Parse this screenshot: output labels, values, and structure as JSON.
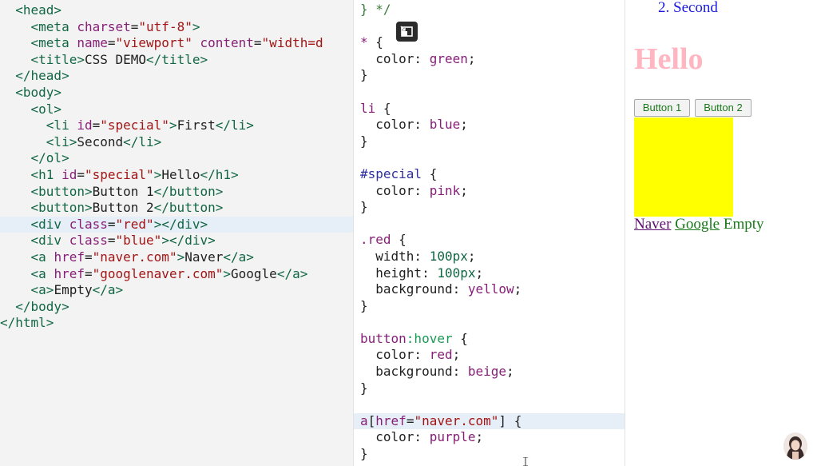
{
  "editor": {
    "html_lines": [
      {
        "indent": "  ",
        "parts": [
          [
            "tag",
            "<head>"
          ]
        ]
      },
      {
        "indent": "    ",
        "parts": [
          [
            "tag",
            "<meta "
          ],
          [
            "attr",
            "charset"
          ],
          [
            "txt",
            "="
          ],
          [
            "str",
            "\"utf-8\""
          ],
          [
            "tag",
            ">"
          ]
        ]
      },
      {
        "indent": "    ",
        "parts": [
          [
            "tag",
            "<meta "
          ],
          [
            "attr",
            "name"
          ],
          [
            "txt",
            "="
          ],
          [
            "str",
            "\"viewport\""
          ],
          [
            "txt",
            " "
          ],
          [
            "attr",
            "content"
          ],
          [
            "txt",
            "="
          ],
          [
            "str",
            "\"width=d"
          ]
        ]
      },
      {
        "indent": "    ",
        "parts": [
          [
            "tag",
            "<title>"
          ],
          [
            "txt",
            "CSS DEMO"
          ],
          [
            "tag",
            "</title>"
          ]
        ]
      },
      {
        "indent": "  ",
        "parts": [
          [
            "tag",
            "</head>"
          ]
        ]
      },
      {
        "indent": "  ",
        "parts": [
          [
            "tag",
            "<body>"
          ]
        ]
      },
      {
        "indent": "    ",
        "parts": [
          [
            "tag",
            "<ol>"
          ]
        ]
      },
      {
        "indent": "      ",
        "parts": [
          [
            "tag",
            "<li "
          ],
          [
            "attr",
            "id"
          ],
          [
            "txt",
            "="
          ],
          [
            "str",
            "\"special\""
          ],
          [
            "tag",
            ">"
          ],
          [
            "txt",
            "First"
          ],
          [
            "tag",
            "</li>"
          ]
        ]
      },
      {
        "indent": "      ",
        "parts": [
          [
            "tag",
            "<li>"
          ],
          [
            "txt",
            "Second"
          ],
          [
            "tag",
            "</li>"
          ]
        ]
      },
      {
        "indent": "    ",
        "parts": [
          [
            "tag",
            "</ol>"
          ]
        ]
      },
      {
        "indent": "    ",
        "parts": [
          [
            "tag",
            "<h1 "
          ],
          [
            "attr",
            "id"
          ],
          [
            "txt",
            "="
          ],
          [
            "str",
            "\"special\""
          ],
          [
            "tag",
            ">"
          ],
          [
            "txt",
            "Hello"
          ],
          [
            "tag",
            "</h1>"
          ]
        ]
      },
      {
        "indent": "    ",
        "parts": [
          [
            "tag",
            "<button>"
          ],
          [
            "txt",
            "Button 1"
          ],
          [
            "tag",
            "</button>"
          ]
        ]
      },
      {
        "indent": "    ",
        "parts": [
          [
            "tag",
            "<button>"
          ],
          [
            "txt",
            "Button 2"
          ],
          [
            "tag",
            "</button>"
          ]
        ]
      },
      {
        "indent": "    ",
        "parts": [
          [
            "tag",
            "<div "
          ],
          [
            "attr",
            "class"
          ],
          [
            "txt",
            "="
          ],
          [
            "str",
            "\"red\""
          ],
          [
            "tag",
            "></div>"
          ]
        ],
        "active": true
      },
      {
        "indent": "    ",
        "parts": [
          [
            "tag",
            "<div "
          ],
          [
            "attr",
            "class"
          ],
          [
            "txt",
            "="
          ],
          [
            "str",
            "\"blue\""
          ],
          [
            "tag",
            "></div>"
          ]
        ]
      },
      {
        "indent": "    ",
        "parts": [
          [
            "tag",
            "<a "
          ],
          [
            "attr",
            "href"
          ],
          [
            "txt",
            "="
          ],
          [
            "str",
            "\"naver.com\""
          ],
          [
            "tag",
            ">"
          ],
          [
            "txt",
            "Naver"
          ],
          [
            "tag",
            "</a>"
          ]
        ]
      },
      {
        "indent": "    ",
        "parts": [
          [
            "tag",
            "<a "
          ],
          [
            "attr",
            "href"
          ],
          [
            "txt",
            "="
          ],
          [
            "str",
            "\"googlenaver.com\""
          ],
          [
            "tag",
            ">"
          ],
          [
            "txt",
            "Google"
          ],
          [
            "tag",
            "</a>"
          ]
        ]
      },
      {
        "indent": "    ",
        "parts": [
          [
            "tag",
            "<a>"
          ],
          [
            "txt",
            "Empty"
          ],
          [
            "tag",
            "</a>"
          ]
        ]
      },
      {
        "indent": "  ",
        "parts": [
          [
            "tag",
            "</body>"
          ]
        ]
      },
      {
        "indent": "",
        "parts": [
          [
            "tag",
            "</html>"
          ]
        ]
      }
    ],
    "css_lines": [
      {
        "parts": [
          [
            "c-comment",
            "} */"
          ]
        ]
      },
      {
        "parts": []
      },
      {
        "parts": [
          [
            "c-sel",
            "* "
          ],
          [
            "c-punc",
            "{"
          ]
        ]
      },
      {
        "parts": [
          [
            "c-prop",
            "  color: "
          ],
          [
            "c-val",
            "green"
          ],
          [
            "c-punc",
            ";"
          ]
        ]
      },
      {
        "parts": [
          [
            "c-punc",
            "}"
          ]
        ]
      },
      {
        "parts": []
      },
      {
        "parts": [
          [
            "c-sel",
            "li "
          ],
          [
            "c-punc",
            "{"
          ]
        ]
      },
      {
        "parts": [
          [
            "c-prop",
            "  color: "
          ],
          [
            "c-val",
            "blue"
          ],
          [
            "c-punc",
            ";"
          ]
        ]
      },
      {
        "parts": [
          [
            "c-punc",
            "}"
          ]
        ]
      },
      {
        "parts": []
      },
      {
        "parts": [
          [
            "c-id",
            "#special "
          ],
          [
            "c-punc",
            "{"
          ]
        ]
      },
      {
        "parts": [
          [
            "c-prop",
            "  color: "
          ],
          [
            "c-val",
            "pink"
          ],
          [
            "c-punc",
            ";"
          ]
        ]
      },
      {
        "parts": [
          [
            "c-punc",
            "}"
          ]
        ]
      },
      {
        "parts": []
      },
      {
        "parts": [
          [
            "c-sel",
            ".red "
          ],
          [
            "c-punc",
            "{"
          ]
        ]
      },
      {
        "parts": [
          [
            "c-prop",
            "  width: "
          ],
          [
            "c-num",
            "100px"
          ],
          [
            "c-punc",
            ";"
          ]
        ]
      },
      {
        "parts": [
          [
            "c-prop",
            "  height: "
          ],
          [
            "c-num",
            "100px"
          ],
          [
            "c-punc",
            ";"
          ]
        ]
      },
      {
        "parts": [
          [
            "c-prop",
            "  background: "
          ],
          [
            "c-val",
            "yellow"
          ],
          [
            "c-punc",
            ";"
          ]
        ]
      },
      {
        "parts": [
          [
            "c-punc",
            "}"
          ]
        ]
      },
      {
        "parts": []
      },
      {
        "parts": [
          [
            "c-sel",
            "button"
          ],
          [
            "c-pseudo",
            ":hover"
          ],
          [
            "c-punc",
            " {"
          ]
        ]
      },
      {
        "parts": [
          [
            "c-prop",
            "  color: "
          ],
          [
            "c-val",
            "red"
          ],
          [
            "c-punc",
            ";"
          ]
        ]
      },
      {
        "parts": [
          [
            "c-prop",
            "  background: "
          ],
          [
            "c-val",
            "beige"
          ],
          [
            "c-punc",
            ";"
          ]
        ]
      },
      {
        "parts": [
          [
            "c-punc",
            "}"
          ]
        ]
      },
      {
        "parts": []
      },
      {
        "parts": [
          [
            "c-sel",
            "a"
          ],
          [
            "c-punc",
            "["
          ],
          [
            "c-sel",
            "href"
          ],
          [
            "c-punc",
            "="
          ],
          [
            "c-str",
            "\"naver.com\""
          ],
          [
            "c-punc",
            "] {"
          ]
        ],
        "active": true
      },
      {
        "parts": [
          [
            "c-prop",
            "  color: "
          ],
          [
            "c-val",
            "purple"
          ],
          [
            "c-punc",
            ";"
          ]
        ]
      },
      {
        "parts": [
          [
            "c-punc",
            "}"
          ]
        ]
      }
    ]
  },
  "preview": {
    "list_item_second": "2. Second",
    "heading": "Hello",
    "button1": "Button 1",
    "button2": "Button 2",
    "link_naver": "Naver",
    "link_google": "Google",
    "link_empty": "Empty"
  },
  "icons": {
    "collapse": "collapse-panel-icon",
    "cursor": "text-cursor-icon",
    "avatar": "presenter-avatar"
  },
  "colors": {
    "red_box": "#ffff00",
    "heading": "#ffb6c1",
    "li_color": "#1a1ae0",
    "button_text": "#1a7a1a",
    "link_naver": "#5c0f6e",
    "link_google": "#1a7a1a"
  }
}
